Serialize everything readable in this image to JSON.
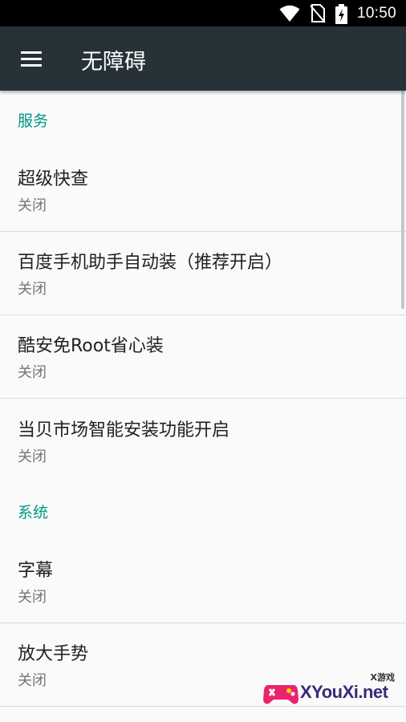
{
  "status_bar": {
    "time": "10:50",
    "icons": [
      "wifi-icon",
      "no-sim-icon",
      "battery-charging-icon"
    ]
  },
  "app_bar": {
    "menu_icon": "menu-icon",
    "title": "无障碍"
  },
  "sections": [
    {
      "header": "服务",
      "items": [
        {
          "title": "超级快查",
          "summary": "关闭"
        },
        {
          "title": "百度手机助手自动装（推荐开启）",
          "summary": "关闭"
        },
        {
          "title": "酷安免Root省心装",
          "summary": "关闭"
        },
        {
          "title": "当贝市场智能安装功能开启",
          "summary": "关闭"
        }
      ]
    },
    {
      "header": "系统",
      "items": [
        {
          "title": "字幕",
          "summary": "关闭"
        },
        {
          "title": "放大手势",
          "summary": "关闭"
        }
      ]
    }
  ],
  "watermark": {
    "text": "XYouXi.net",
    "small_text": "X游戏"
  },
  "colors": {
    "app_bar": "#263238",
    "accent": "#009688",
    "status_bar": "#000000",
    "background": "#fafafa"
  }
}
